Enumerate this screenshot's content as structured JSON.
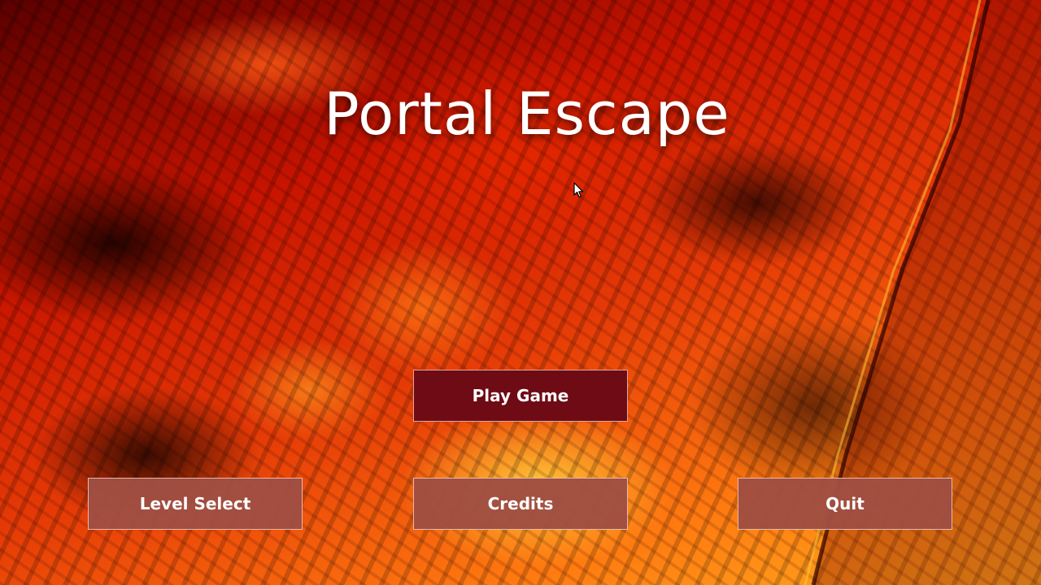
{
  "title": "Portal Escape",
  "buttons": {
    "play_game": "Play Game",
    "level_select": "Level Select",
    "credits": "Credits",
    "quit": "Quit"
  },
  "colors": {
    "primary_button": "#6e0b14",
    "secondary_button": "#a04e42",
    "title_text": "#ffffff",
    "background_lava": "#e53a06"
  },
  "icons": {
    "cursor": "mouse-pointer-icon"
  }
}
